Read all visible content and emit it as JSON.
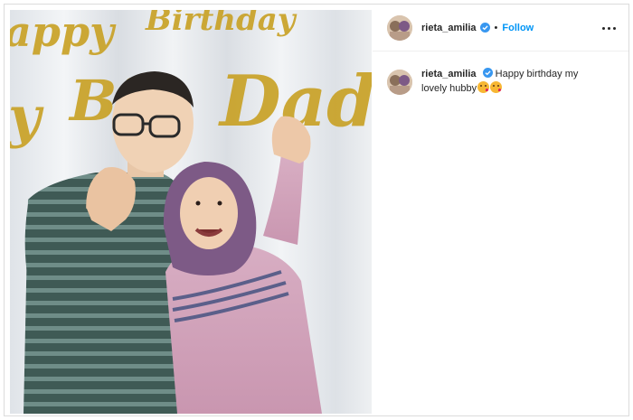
{
  "post": {
    "username": "rieta_amilia",
    "separator": "•",
    "follow_label": "Follow",
    "more_icon": "more-options-icon",
    "verified_icon": "verified-badge-icon"
  },
  "caption": {
    "username": "rieta_amilia",
    "text": "Happy birthday my lovely hubby",
    "emojis": [
      "face-blowing-kiss",
      "face-blowing-kiss"
    ]
  },
  "photo": {
    "banner_text": "Happy Birthday Daddy"
  },
  "colors": {
    "accent": "#0095f6",
    "verified": "#3897f0",
    "banner_gold": "#c9a227"
  }
}
